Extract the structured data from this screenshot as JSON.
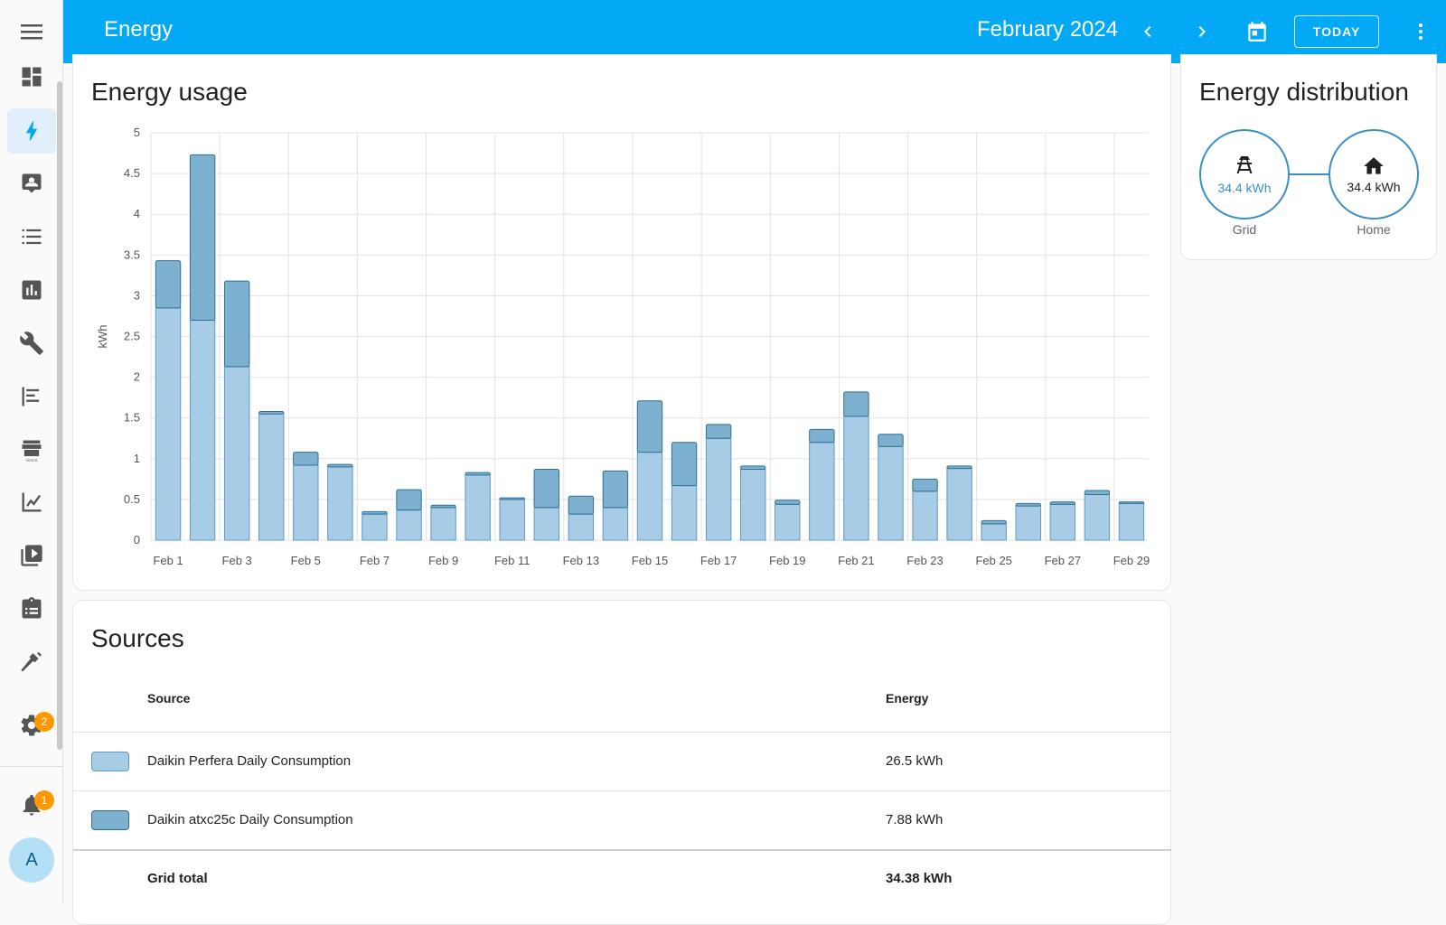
{
  "header": {
    "title": "Energy",
    "period": "February 2024",
    "today_label": "TODAY"
  },
  "sidebar": {
    "items": [
      {
        "name": "overview",
        "icon": "dashboard-icon"
      },
      {
        "name": "energy",
        "icon": "lightning-icon",
        "active": true
      },
      {
        "name": "map",
        "icon": "account-box-icon"
      },
      {
        "name": "logbook",
        "icon": "list-icon"
      },
      {
        "name": "history",
        "icon": "bar-chart-icon"
      },
      {
        "name": "tools",
        "icon": "wrench-icon"
      },
      {
        "name": "areas",
        "icon": "format-align-icon"
      },
      {
        "name": "hacs",
        "icon": "hacs-store-icon"
      },
      {
        "name": "statistics",
        "icon": "line-chart-icon"
      },
      {
        "name": "media",
        "icon": "play-box-icon"
      },
      {
        "name": "todo",
        "icon": "clipboard-icon"
      },
      {
        "name": "developer-tools",
        "icon": "hammer-icon"
      },
      {
        "name": "settings",
        "icon": "gear-icon",
        "badge": "2"
      }
    ],
    "notifications_badge": "1",
    "avatar_letter": "A"
  },
  "usage": {
    "title": "Energy usage"
  },
  "chart_data": {
    "type": "bar",
    "stacked": true,
    "ylabel": "kWh",
    "ylim": [
      0,
      5
    ],
    "yticks": [
      "0",
      "0.5",
      "1",
      "1.5",
      "2",
      "2.5",
      "3",
      "3.5",
      "4",
      "4.5",
      "5"
    ],
    "xticks": [
      "Feb 1",
      "Feb 3",
      "Feb 5",
      "Feb 7",
      "Feb 9",
      "Feb 11",
      "Feb 13",
      "Feb 15",
      "Feb 17",
      "Feb 19",
      "Feb 21",
      "Feb 23",
      "Feb 25",
      "Feb 27",
      "Feb 29"
    ],
    "categories": [
      "Feb 1",
      "Feb 2",
      "Feb 3",
      "Feb 4",
      "Feb 5",
      "Feb 6",
      "Feb 7",
      "Feb 8",
      "Feb 9",
      "Feb 10",
      "Feb 11",
      "Feb 12",
      "Feb 13",
      "Feb 14",
      "Feb 15",
      "Feb 16",
      "Feb 17",
      "Feb 18",
      "Feb 19",
      "Feb 20",
      "Feb 21",
      "Feb 22",
      "Feb 23",
      "Feb 24",
      "Feb 25",
      "Feb 26",
      "Feb 27",
      "Feb 28",
      "Feb 29"
    ],
    "series": [
      {
        "name": "Daikin Perfera Daily Consumption",
        "color": "#a8cbe6",
        "stroke": "#5b9bc9",
        "values": [
          2.85,
          2.7,
          2.13,
          1.55,
          0.92,
          0.9,
          0.32,
          0.37,
          0.4,
          0.8,
          0.5,
          0.4,
          0.32,
          0.4,
          1.08,
          0.67,
          1.25,
          0.87,
          0.44,
          1.2,
          1.52,
          1.15,
          0.6,
          0.88,
          0.2,
          0.42,
          0.44,
          0.56,
          0.45
        ]
      },
      {
        "name": "Daikin atxc25c Daily Consumption",
        "color": "#7eb0cf",
        "stroke": "#2f6f96",
        "values": [
          0.58,
          2.03,
          1.05,
          0.03,
          0.16,
          0.03,
          0.03,
          0.25,
          0.03,
          0.03,
          0.02,
          0.47,
          0.22,
          0.45,
          0.63,
          0.53,
          0.17,
          0.04,
          0.05,
          0.16,
          0.3,
          0.15,
          0.15,
          0.03,
          0.04,
          0.03,
          0.03,
          0.05,
          0.02
        ]
      }
    ],
    "grid": true
  },
  "distribution": {
    "title": "Energy distribution",
    "grid_value": "34.4 kWh",
    "grid_label": "Grid",
    "home_value": "34.4 kWh",
    "home_label": "Home",
    "accent": "#3b8fc4"
  },
  "sources": {
    "title": "Sources",
    "col_source": "Source",
    "col_energy": "Energy",
    "rows": [
      {
        "name": "Daikin Perfera Daily Consumption",
        "energy": "26.5 kWh",
        "color": "#a8cbe6",
        "stroke": "#5b9bc9"
      },
      {
        "name": "Daikin atxc25c Daily Consumption",
        "energy": "7.88 kWh",
        "color": "#7eb0cf",
        "stroke": "#2f6f96"
      }
    ],
    "total_label": "Grid total",
    "total_value": "34.38 kWh"
  }
}
